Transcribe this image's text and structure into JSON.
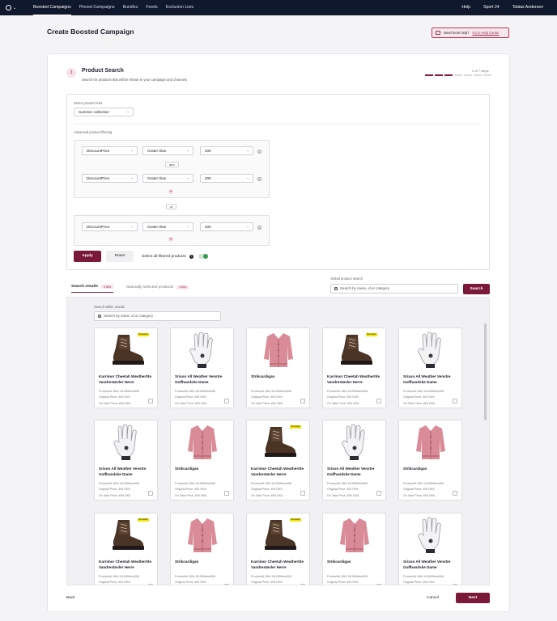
{
  "topbar": {
    "nav": [
      "Boosted Campaigns",
      "Pinned Campaigns",
      "Bundles",
      "Feeds",
      "Exclusion Lists"
    ],
    "active": "Boosted Campaigns",
    "right": [
      "Help",
      "Sport 24",
      "Tobias Andersen"
    ]
  },
  "page": {
    "title": "Create Boosted Campaign",
    "help_text": "Need more help?",
    "help_link": "Go to Help Center"
  },
  "step": {
    "number": "3",
    "title": "Product Search",
    "subtitle": "Search for products that will be shown in your campaign and channels",
    "count": "3 of 7 steps",
    "total": 7,
    "current": 3
  },
  "filters": {
    "feed_label": "Select product feed",
    "feed_value": "Summer collection",
    "advanced_label": "Advanced product filtering",
    "rows": [
      {
        "field": "DiscountPrice",
        "op": "Grater than",
        "value": "200"
      },
      {
        "field": "DiscountPrice",
        "op": "Grater than",
        "value": "200"
      },
      {
        "field": "DiscountPrice",
        "op": "Grater than",
        "value": "200"
      }
    ],
    "and_label": "and",
    "or_label": "or",
    "apply": "Apply",
    "reset": "Reset",
    "select_all": "Select all filtered products"
  },
  "tabs": [
    {
      "label": "Search results",
      "count": "2.654"
    },
    {
      "label": "Manually selected products",
      "count": "2.654"
    }
  ],
  "global_search": {
    "label": "Global product search",
    "placeholder": "Search by name, id or category",
    "button": "Search"
  },
  "results_search": {
    "label": "Search within results",
    "placeholder": "Search by name, id or category"
  },
  "products": [
    {
      "name": "Karrimor Cheetah Weathertite Vandrestøvler Herre",
      "type": "boot",
      "tag": "Bestseller"
    },
    {
      "name": "Srixon All Weather Venstre Golfhandske Dame",
      "type": "glove"
    },
    {
      "name": "Strikcardigan",
      "type": "cardigan"
    },
    {
      "name": "Karrimor Cheetah Weathertite Vandrestøvler Herre",
      "type": "boot",
      "tag": "Bestseller"
    },
    {
      "name": "Srixon All Weather Venstre Golfhandske Dame",
      "type": "glove"
    },
    {
      "name": "Srixon All Weather Venstre Golfhandske Dame",
      "type": "glove"
    },
    {
      "name": "Strikcardigan",
      "type": "cardigan"
    },
    {
      "name": "Karrimor Cheetah Weathertite Vandrestøvler Herre",
      "type": "boot",
      "tag": "Bestseller"
    },
    {
      "name": "Srixon All Weather Venstre Golfhandske Dame",
      "type": "glove"
    },
    {
      "name": "Strikcardigan",
      "type": "cardigan"
    },
    {
      "name": "Karrimor Cheetah Weathertite Vandrestøvler Herre",
      "type": "boot",
      "tag": "Bestseller"
    },
    {
      "name": "Strikcardigan",
      "type": "cardigan"
    },
    {
      "name": "Karrimor Cheetah Weathertite Vandrestøvler Herre",
      "type": "boot",
      "tag": "Bestseller"
    },
    {
      "name": "Strikcardigan",
      "type": "cardigan"
    },
    {
      "name": "Srixon All Weather Venstre Golfhandske Dame",
      "type": "glove"
    }
  ],
  "product_meta": {
    "id": "ProductId: 894-111999item006",
    "original": "Original Price: 400 DKK",
    "sale": "On Sale Price: 800 DKK"
  },
  "footer": {
    "back": "Back",
    "cancel": "Cancel",
    "next": "Next"
  }
}
